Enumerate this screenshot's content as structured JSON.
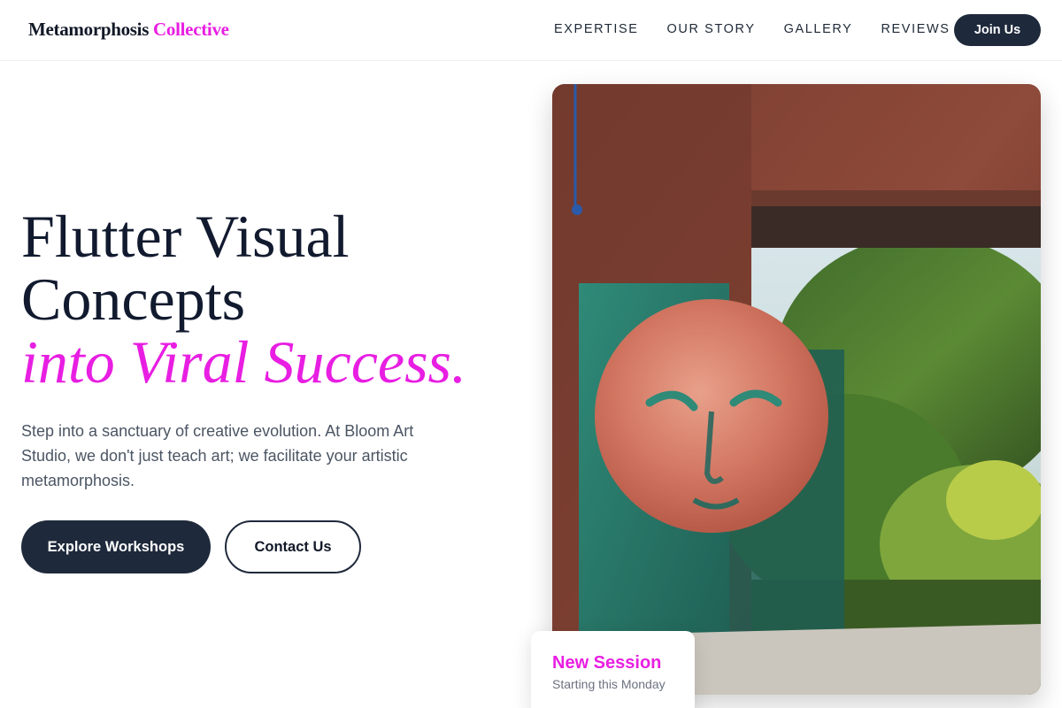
{
  "brand": {
    "name": "Metamorphosis",
    "accent": "Collective"
  },
  "nav": {
    "links": [
      "EXPERTISE",
      "OUR STORY",
      "GALLERY",
      "REVIEWS"
    ],
    "cta": "Join Us"
  },
  "hero": {
    "headline_line1": "Flutter Visual",
    "headline_line2": "Concepts",
    "headline_accent": "into Viral Success.",
    "intro": "Step into a sanctuary of creative evolution. At Bloom Art Studio, we don't just teach art; we facilitate your artistic metamorphosis.",
    "primary_button": "Explore Workshops",
    "secondary_button": "Contact Us"
  },
  "session_card": {
    "title": "New Session",
    "subtitle": "Starting this Monday"
  },
  "colors": {
    "accent": "#e81ee2",
    "dark": "#1e293b"
  }
}
